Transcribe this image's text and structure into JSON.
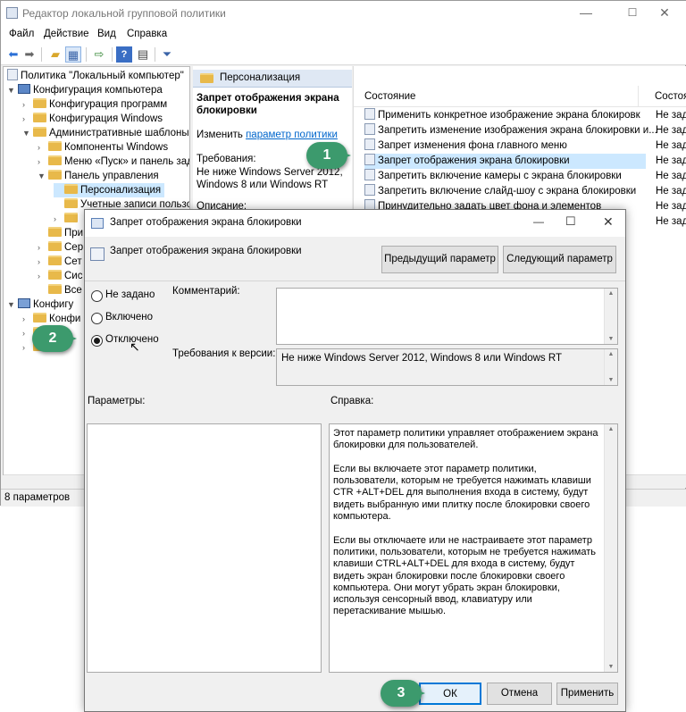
{
  "window": {
    "title": "Редактор локальной групповой политики",
    "minimize": "—",
    "maximize": "☐",
    "close": "✕"
  },
  "menu": [
    "Файл",
    "Действие",
    "Вид",
    "Справка"
  ],
  "toolbar_icons": [
    "back-arrow-icon",
    "forward-arrow-icon",
    "up-folder-icon",
    "show-hide-tree-icon",
    "export-list-icon",
    "help-icon",
    "properties-icon",
    "filter-icon"
  ],
  "tree": {
    "items": [
      {
        "label": "Политика \"Локальный компьютер\"",
        "icon": "policy-icon"
      },
      {
        "label": "Конфигурация компьютера",
        "icon": "computer-icon",
        "arrow": "▼"
      },
      {
        "label": "Конфигурация программ",
        "icon": "folder-icon",
        "arrow": "›"
      },
      {
        "label": "Конфигурация Windows",
        "icon": "folder-icon",
        "arrow": "›"
      },
      {
        "label": "Административные шаблоны",
        "icon": "folder-icon",
        "arrow": "▼"
      },
      {
        "label": "Компоненты Windows",
        "icon": "folder-icon",
        "arrow": "›"
      },
      {
        "label": "Меню «Пуск» и панель зад",
        "icon": "folder-icon",
        "arrow": "›"
      },
      {
        "label": "Панель управления",
        "icon": "folder-icon",
        "arrow": "▼"
      },
      {
        "label": "Персонализация",
        "icon": "folder-icon",
        "selected": true
      },
      {
        "label": "Учетные записи пользов",
        "icon": "folder-icon"
      },
      {
        "label": "",
        "icon": "folder-icon",
        "arrow": "›"
      },
      {
        "label": "При",
        "icon": "folder-icon"
      },
      {
        "label": "Сер",
        "icon": "folder-icon",
        "arrow": "›"
      },
      {
        "label": "Сет",
        "icon": "folder-icon",
        "arrow": "›"
      },
      {
        "label": "Сис",
        "icon": "folder-icon",
        "arrow": "›"
      },
      {
        "label": "Все",
        "icon": "folder-icon"
      },
      {
        "label": "Конфигу",
        "icon": "user-icon",
        "arrow": "▼"
      },
      {
        "label": "Конфи",
        "icon": "folder-icon",
        "arrow": "›"
      },
      {
        "label": "фи",
        "icon": "folder-icon",
        "arrow": "›"
      },
      {
        "label": "ни",
        "icon": "folder-icon",
        "arrow": "›"
      }
    ]
  },
  "status": "8 параметров",
  "desc": {
    "header": "Персонализация",
    "title": "Запрет отображения экрана блокировки",
    "edit_prefix": "Изменить ",
    "edit_link": "параметр политики",
    "req_label": "Требования:",
    "req_value": "Не ниже Windows Server 2012, Windows 8 или Windows RT",
    "desc_label": "Описание:"
  },
  "list": {
    "col_state": "Состояние",
    "col_state2": "Состоя",
    "rows": [
      {
        "name": "Применить конкретное изображение экрана блокировк",
        "state": "Не зад"
      },
      {
        "name": "Запретить изменение изображения экрана блокировки и...",
        "state": "Не зад"
      },
      {
        "name": "Запрет изменения фона главного меню",
        "state": "Не зад"
      },
      {
        "name": "Запрет отображения экрана блокировки",
        "state": "Не зад",
        "selected": true
      },
      {
        "name": "Запретить включение камеры с экрана блокировки",
        "state": "Не зад"
      },
      {
        "name": "Запретить включение слайд-шоу с экрана блокировки",
        "state": "Не зад"
      },
      {
        "name": "Принудительно задать цвет фона и элементов",
        "state": "Не зад"
      },
      {
        "name": "",
        "state": "Не зад"
      }
    ]
  },
  "dialog": {
    "title": "Запрет отображения экрана блокировки",
    "policy_name": "Запрет отображения экрана блокировки",
    "prev_button": "Предыдущий параметр",
    "next_button": "Следующий параметр",
    "radio_not_configured": "Не задано",
    "radio_enabled": "Включено",
    "radio_disabled": "Отключено",
    "selected_option": "Отключено",
    "comment_label": "Комментарий:",
    "comment_value": "",
    "supported_label": "Требования к версии:",
    "supported_value": "Не ниже Windows Server 2012, Windows 8 или Windows RT",
    "options_label": "Параметры:",
    "help_label": "Справка:",
    "help_text": "Этот параметр политики управляет отображением экрана блокировки для пользователей.\n\nЕсли вы включаете этот параметр политики, пользователи, которым не требуется нажимать клавиши CTR +ALT+DEL для выполнения входа в систему, будут видеть выбранную ими плитку после блокировки своего компьютера.\n\nЕсли вы отключаете или не настраиваете этот параметр политики, пользователи, которым не требуется нажимать клавиши CTRL+ALT+DEL для входа в систему, будут видеть экран блокировки после блокировки своего компьютера. Они могут убрать экран блокировки, используя сенсорный ввод, клавиатуру или перетаскивание мышью.",
    "ok_button": "ОК",
    "cancel_button": "Отмена",
    "apply_button": "Применить"
  },
  "callouts": [
    "1",
    "2",
    "3"
  ],
  "colors": {
    "callout": "#3c9a6d",
    "selection": "#cce8ff",
    "link": "#0066cc"
  }
}
